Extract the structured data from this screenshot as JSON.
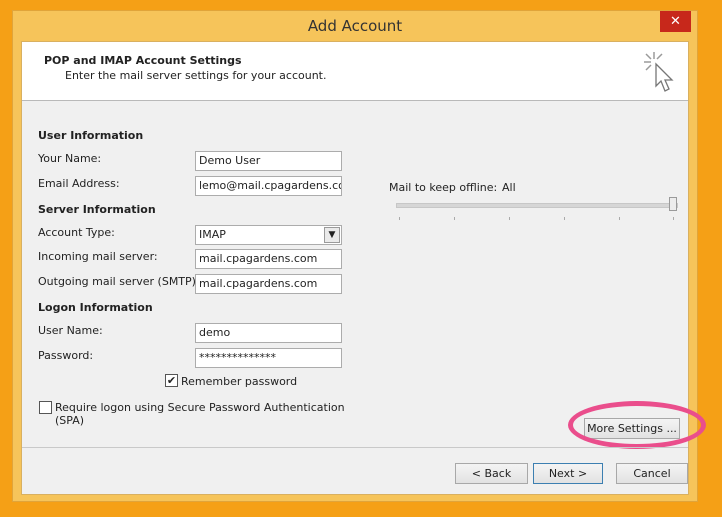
{
  "window": {
    "title": "Add Account",
    "close_label": "✕"
  },
  "header": {
    "title": "POP and IMAP Account Settings",
    "subtitle": "Enter the mail server settings for your account."
  },
  "user_info": {
    "section": "User Information",
    "name_label": "Your Name:",
    "name_value": "Demo User",
    "email_label": "Email Address:",
    "email_value": "lemo@mail.cpagardens.com"
  },
  "server_info": {
    "section": "Server Information",
    "account_type_label": "Account Type:",
    "account_type_value": "IMAP",
    "incoming_label": "Incoming mail server:",
    "incoming_value": "mail.cpagardens.com",
    "outgoing_label": "Outgoing mail server (SMTP):",
    "outgoing_value": "mail.cpagardens.com"
  },
  "logon_info": {
    "section": "Logon Information",
    "username_label": "User Name:",
    "username_value": "demo",
    "password_label": "Password:",
    "password_value": "**************",
    "remember_label": "Remember password",
    "remember_checked": true,
    "spa_label_line1": "Require logon using Secure Password Authentication",
    "spa_label_line2": "(SPA)",
    "spa_checked": false
  },
  "offline": {
    "label": "Mail to keep offline:",
    "value": "All",
    "level": 1.0
  },
  "buttons": {
    "more_settings": "More Settings ...",
    "back": "< Back",
    "next": "Next >",
    "cancel": "Cancel"
  },
  "colors": {
    "background": "#f5a016",
    "highlight_ring": "#ea4e8c",
    "close_button": "#c7281b"
  },
  "icons": {
    "header_icon": "cursor-click-icon",
    "dropdown": "chevron-down-icon",
    "check": "check-icon"
  }
}
